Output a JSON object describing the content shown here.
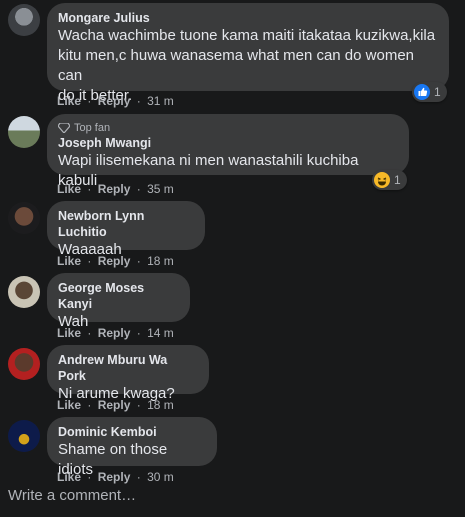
{
  "comments": [
    {
      "name": "Mongare Julius",
      "text_lines": [
        "Wacha wachimbe tuone kama maiti itakataa kuzikwa,kila",
        "kitu men,c huwa wanasema what men can do women can",
        "do it better."
      ],
      "like": "Like",
      "reply": "Reply",
      "sep": "·",
      "time": "31 m",
      "reaction_count": "1",
      "reaction": "like-icon"
    },
    {
      "badge": "Top fan",
      "name": "Joseph Mwangi",
      "text": "Wapi ilisemekana ni men wanastahili kuchiba kabuli",
      "like": "Like",
      "reply": "Reply",
      "sep": "·",
      "time": "35 m",
      "reaction_count": "1",
      "reaction": "haha-icon"
    },
    {
      "name": "Newborn Lynn Luchitio",
      "text": "Waaaaah",
      "like": "Like",
      "reply": "Reply",
      "sep": "·",
      "time": "18 m"
    },
    {
      "name": "George Moses Kanyi",
      "text": "Wah",
      "like": "Like",
      "reply": "Reply",
      "sep": "·",
      "time": "14 m"
    },
    {
      "name": "Andrew Mburu Wa Pork",
      "text": "Ni arume kwaga?",
      "like": "Like",
      "reply": "Reply",
      "sep": "·",
      "time": "18 m"
    },
    {
      "name": "Dominic Kemboi",
      "text": "Shame on those idiots",
      "like": "Like",
      "reply": "Reply",
      "sep": "·",
      "time": "30 m"
    }
  ],
  "write_comment_placeholder": "Write a comment…",
  "colors": {
    "background": "#18191a",
    "bubble": "#3a3b3c",
    "like_blue": "#1877f2",
    "haha_yellow": "#f7b928"
  }
}
